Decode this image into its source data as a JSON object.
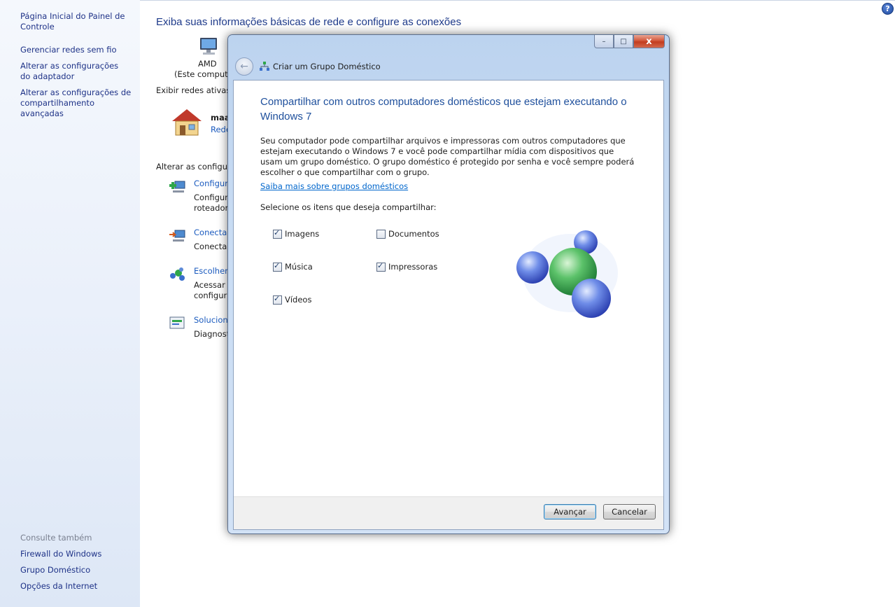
{
  "sidebar": {
    "links": [
      "Página Inicial do Painel de Controle",
      "Gerenciar redes sem fio",
      "Alterar as configurações do adaptador",
      "Alterar as configurações de compartilhamento avançadas"
    ],
    "see_also_label": "Consulte também",
    "see_also": [
      "Firewall do Windows",
      "Grupo Doméstico",
      "Opções da Internet"
    ]
  },
  "main": {
    "title": "Exiba suas informações básicas de rede e configure as conexões",
    "computer_name": "AMD",
    "computer_sub": "(Este computa",
    "active_networks_label": "Exibir redes ativas",
    "network_name": "maa",
    "network_link": "Rede",
    "change_settings_label": "Alterar as configura",
    "tasks": [
      {
        "link": "Configur",
        "desc1": "Configur",
        "desc2": "roteador"
      },
      {
        "link": "Conectar",
        "desc1": "Conectar",
        "desc2": ""
      },
      {
        "link": "Escolher",
        "desc1": "Acessar a",
        "desc2": "configura"
      },
      {
        "link": "Soluciona",
        "desc1": "Diagnost",
        "desc2": ""
      }
    ]
  },
  "dialog": {
    "title": "Criar um Grupo Doméstico",
    "heading": "Compartilhar com outros computadores domésticos que estejam executando o Windows 7",
    "description": "Seu computador pode compartilhar arquivos e impressoras com outros computadores que estejam executando o Windows 7 e você pode compartilhar mídia com dispositivos que usam um grupo doméstico. O grupo doméstico é protegido por senha e você sempre poderá escolher o que compartilhar com o grupo.",
    "learn_more": "Saiba mais sobre grupos domésticos",
    "select_label": "Selecione os itens que deseja compartilhar:",
    "items": [
      {
        "label": "Imagens",
        "checked": true
      },
      {
        "label": "Documentos",
        "checked": false
      },
      {
        "label": "Música",
        "checked": true
      },
      {
        "label": "Impressoras",
        "checked": true
      },
      {
        "label": "Vídeos",
        "checked": true
      }
    ],
    "next_button": "Avançar",
    "cancel_button": "Cancelar",
    "caption": {
      "minimize": "–",
      "maximize": "□",
      "close": "x"
    }
  },
  "help_icon_text": "?"
}
